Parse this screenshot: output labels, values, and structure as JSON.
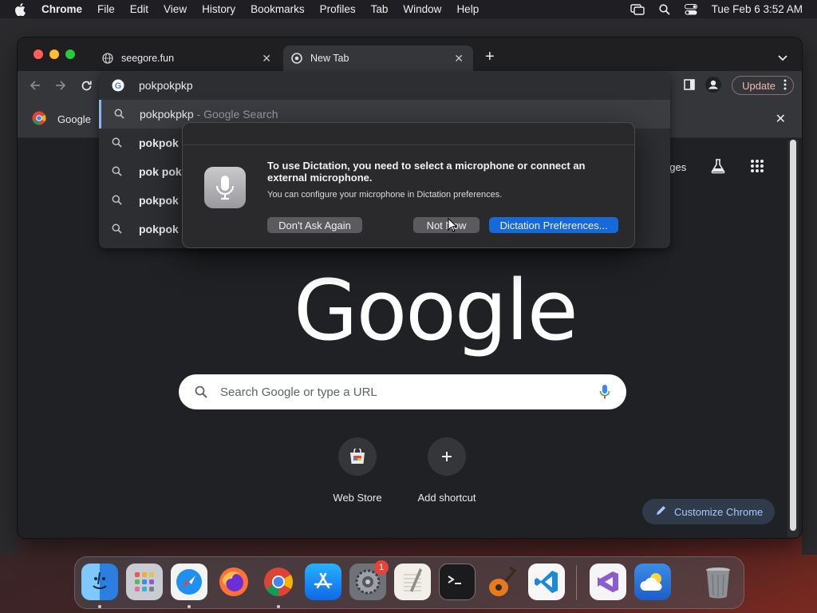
{
  "menubar": {
    "items": [
      "Chrome",
      "File",
      "Edit",
      "View",
      "History",
      "Bookmarks",
      "Profiles",
      "Tab",
      "Window",
      "Help"
    ],
    "datetime": "Tue Feb 6  3:52 AM"
  },
  "tabs": [
    {
      "title": "seegore.fun",
      "icon": "globe-icon"
    },
    {
      "title": "New Tab",
      "icon": "chrome-icon"
    }
  ],
  "toolbar": {
    "omnibox_text": "pokpokpkp",
    "update_label": "Update"
  },
  "bookmarks": {
    "item_label": "Google"
  },
  "suggestions": [
    {
      "bold": "pokpokpkp",
      "suffix": " - Google Search"
    },
    {
      "bold": "pokpok"
    },
    {
      "bold": "pok pok"
    },
    {
      "bold": "pokpok"
    },
    {
      "bold": "pokpok"
    }
  ],
  "dialog": {
    "title": "To use Dictation, you need to select a microphone or connect an external microphone.",
    "subtitle": "You can configure your microphone in Dictation preferences.",
    "btn_dont_ask": "Don't Ask Again",
    "btn_not_now": "Not Now",
    "btn_prefs": "Dictation Preferences..."
  },
  "page": {
    "images_link": "ages",
    "logo_text": "Google",
    "search_placeholder": "Search Google or type a URL",
    "shortcuts": [
      {
        "label": "Web Store",
        "icon": "web-store-icon"
      },
      {
        "label": "Add shortcut",
        "icon": "plus-icon"
      }
    ],
    "customize_label": "Customize Chrome"
  },
  "dock": {
    "apps": [
      "Finder",
      "Launchpad",
      "Safari",
      "Firefox",
      "Chrome",
      "App Store",
      "System Preferences",
      "TextEdit",
      "Terminal",
      "GarageBand",
      "Visual Studio Code",
      "Visual Studio",
      "Weather",
      "Trash"
    ],
    "system_prefs_badge": "1"
  }
}
